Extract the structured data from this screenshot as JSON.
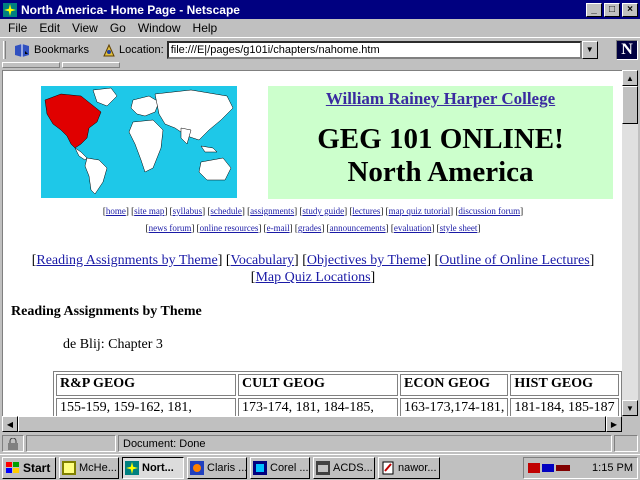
{
  "window": {
    "title": "North America- Home Page - Netscape",
    "buttons": {
      "minimize": "_",
      "maximize": "□",
      "close": "×"
    }
  },
  "menu": [
    "File",
    "Edit",
    "View",
    "Go",
    "Window",
    "Help"
  ],
  "toolbar": {
    "bookmarks_label": "Bookmarks",
    "location_label": "Location:",
    "location_value": "file:///E|/pages/g101i/chapters/nahome.htm"
  },
  "page": {
    "college": "William Rainey Harper College",
    "course": "GEG 101 ONLINE!",
    "region": "North America",
    "nav_row1": [
      "home",
      "site map",
      "syllabus",
      "schedule",
      "assignments",
      "study guide",
      "lectures",
      "map quiz tutorial",
      "discussion forum"
    ],
    "nav_row2": [
      "news forum",
      "online resources",
      "e-mail",
      "grades",
      "announcements",
      "evaluation",
      "style sheet"
    ],
    "top_links": [
      "Reading Assignments by Theme",
      "Vocabulary",
      "Objectives by Theme",
      "Outline of Online Lectures",
      "Map Quiz Locations"
    ],
    "section_heading": "Reading Assignments by Theme",
    "chapter": "de Blij: Chapter 3",
    "table": {
      "headers": [
        "R&P GEOG",
        "CULT GEOG",
        "ECON GEOG",
        "HIST GEOG"
      ],
      "rows": [
        [
          "155-159, 159-162, 181,",
          "173-174, 181, 184-185,",
          "163-173,174-181,",
          "181-184, 185-187"
        ]
      ]
    }
  },
  "status": {
    "text": "Document: Done"
  },
  "taskbar": {
    "start": "Start",
    "tasks": [
      "McHe...",
      "Nort...",
      "Claris ...",
      "Corel ...",
      "ACDS...",
      "nawor..."
    ],
    "active_index": 1,
    "clock": "1:15 PM"
  }
}
